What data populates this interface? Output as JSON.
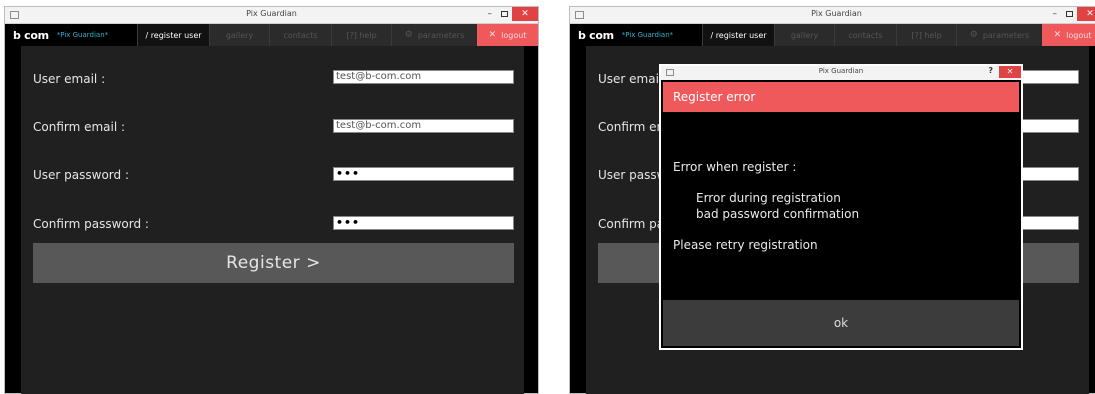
{
  "window": {
    "title": "Pix Guardian",
    "minimize_label": "–",
    "close_label": "✕"
  },
  "nav": {
    "logo": "b com",
    "app_name": "*Pix Guardian*",
    "tabs": [
      {
        "label": "/ register user"
      },
      {
        "label": "gallery"
      },
      {
        "label": "contacts"
      },
      {
        "label": "[?] help"
      },
      {
        "label": "parameters",
        "icon": "gear-icon"
      },
      {
        "label": "logout",
        "icon": "close-icon"
      }
    ]
  },
  "form": {
    "email_label": "User email :",
    "email_value": "test@b-com.com",
    "confirm_email_label": "Confirm email :",
    "confirm_email_value": "test@b-com.com",
    "password_label": "User password :",
    "password_value": "•••",
    "confirm_password_label": "Confirm password :",
    "confirm_password_value": "•••",
    "register_button": "Register >"
  },
  "dialog": {
    "title": "Pix Guardian",
    "help": "?",
    "close": "✕",
    "header": "Register error",
    "line1": "Error when register :",
    "line2": "Error during registration",
    "line3": "bad password confirmation",
    "line4": "Please retry registration",
    "ok": "ok"
  }
}
